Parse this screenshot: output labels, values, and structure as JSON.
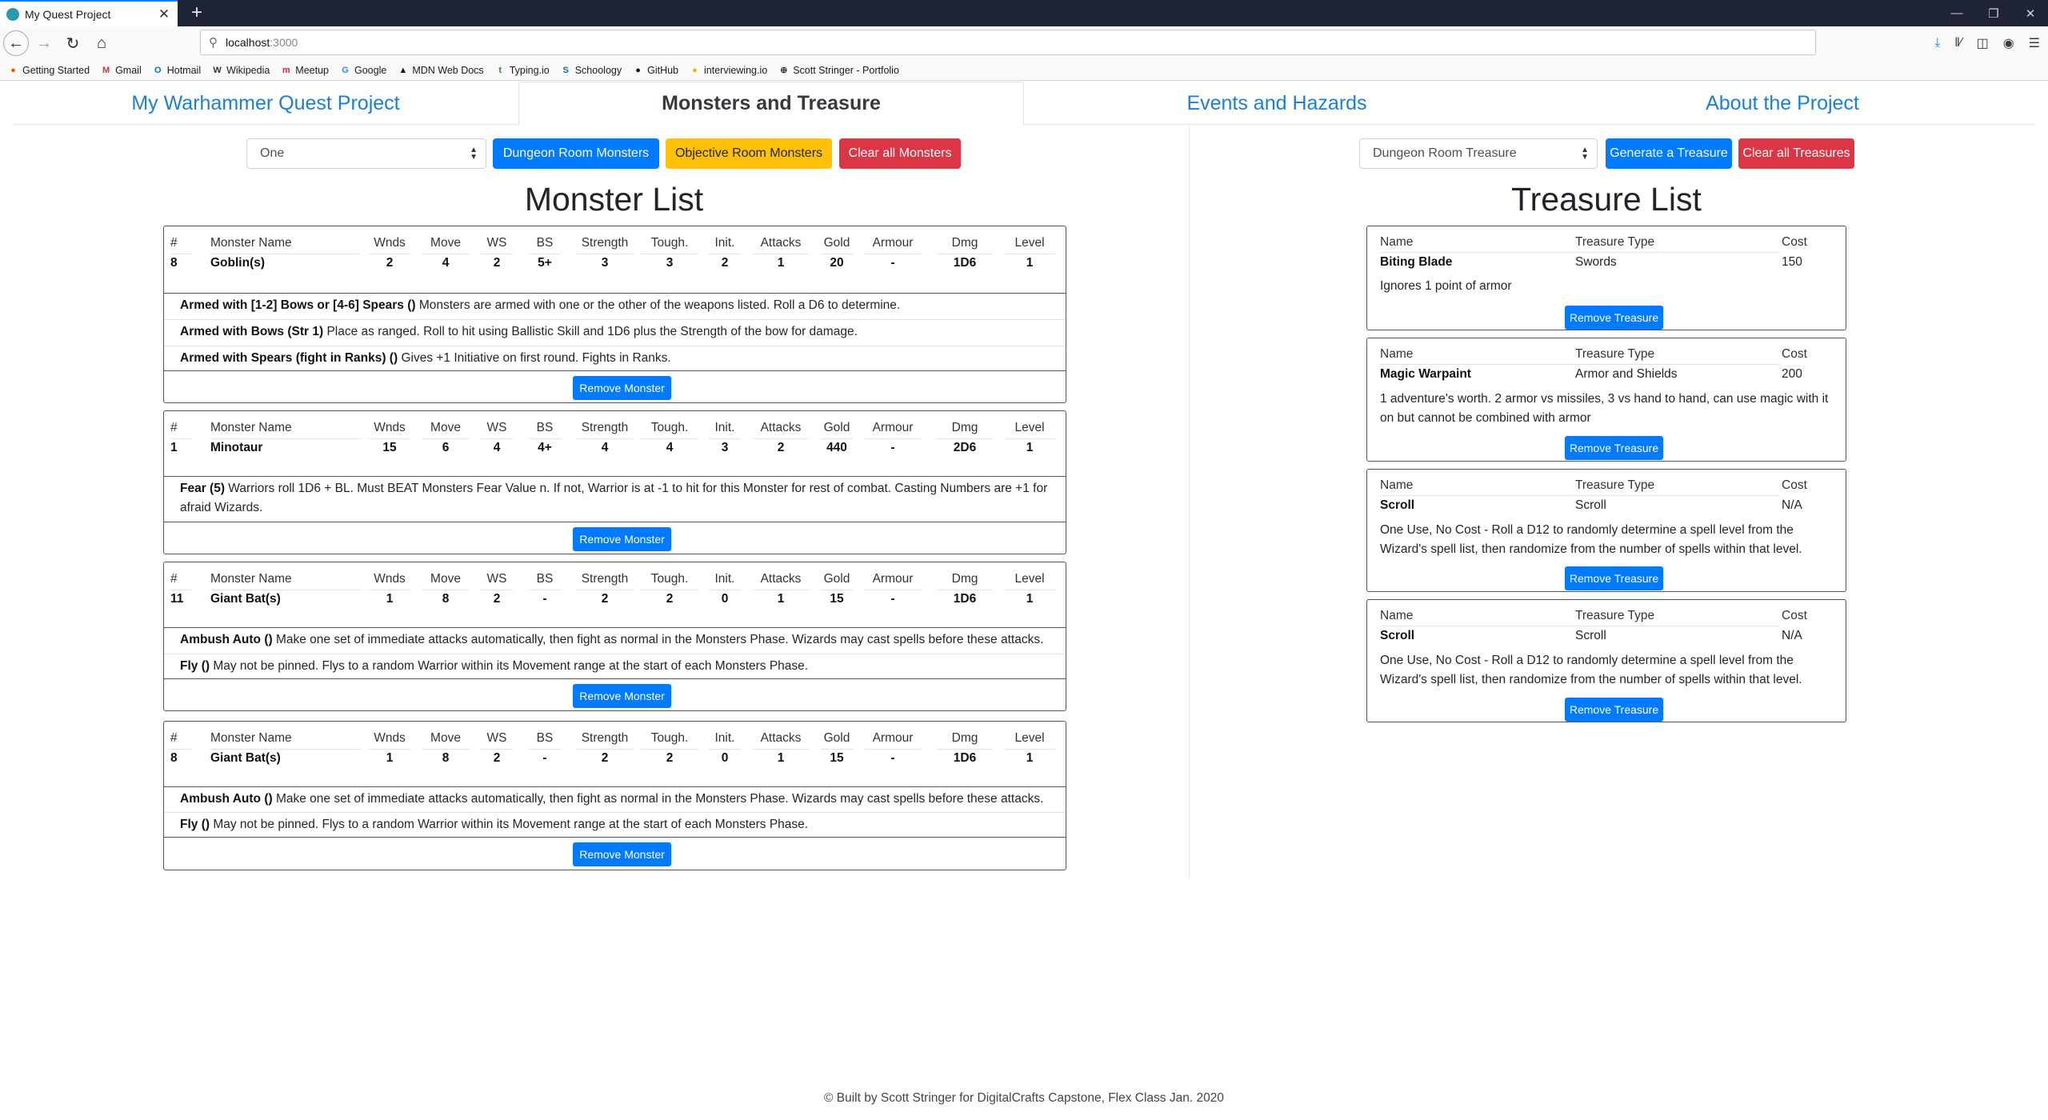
{
  "browser": {
    "tab_title": "My Quest Project",
    "tab_close": "✕",
    "new_tab": "+",
    "url_host": "localhost",
    "url_port": ":3000",
    "bookmarks": [
      {
        "label": "Getting Started",
        "icon": "firefox-icon",
        "color": "#e66000"
      },
      {
        "label": "Gmail",
        "icon": "gmail-icon",
        "color": "#d93025"
      },
      {
        "label": "Hotmail",
        "icon": "outlook-icon",
        "color": "#0072c6"
      },
      {
        "label": "Wikipedia",
        "icon": "wikipedia-icon",
        "color": "#333333"
      },
      {
        "label": "Meetup",
        "icon": "meetup-icon",
        "color": "#ed1c40"
      },
      {
        "label": "Google",
        "icon": "google-icon",
        "color": "#4285f4"
      },
      {
        "label": "MDN Web Docs",
        "icon": "mdn-icon",
        "color": "#1a1a1a"
      },
      {
        "label": "Typing.io",
        "icon": "typing-icon",
        "color": "#2e7d32"
      },
      {
        "label": "Schoology",
        "icon": "schoology-icon",
        "color": "#0b6e99"
      },
      {
        "label": "GitHub",
        "icon": "github-icon",
        "color": "#111111"
      },
      {
        "label": "interviewing.io",
        "icon": "interviewing-icon",
        "color": "#e6b800"
      },
      {
        "label": "Scott Stringer - Portfolio",
        "icon": "globe-icon",
        "color": "#333333"
      }
    ]
  },
  "nav": {
    "tabs": [
      {
        "label": "My Warhammer Quest Project",
        "active": false
      },
      {
        "label": "Monsters and Treasure",
        "active": true
      },
      {
        "label": "Events and Hazards",
        "active": false
      },
      {
        "label": "About the Project",
        "active": false
      }
    ]
  },
  "monster_controls": {
    "count_select": "One",
    "dungeon_btn": "Dungeon Room Monsters",
    "objective_btn": "Objective Room Monsters",
    "clear_btn": "Clear all Monsters"
  },
  "treasure_controls": {
    "type_select": "Dungeon Room Treasure",
    "generate_btn": "Generate a Treasure",
    "clear_btn": "Clear all Treasures"
  },
  "monster_list": {
    "title": "Monster List",
    "headers": [
      "#",
      "Monster Name",
      "Wnds",
      "Move",
      "WS",
      "BS",
      "Strength",
      "Tough.",
      "Init.",
      "Attacks",
      "Gold",
      "Armour",
      "Dmg",
      "Level"
    ],
    "remove_label": "Remove Monster",
    "monsters": [
      {
        "values": [
          "8",
          "Goblin(s)",
          "2",
          "4",
          "2",
          "5+",
          "3",
          "3",
          "2",
          "1",
          "20",
          "-",
          "1D6",
          "1"
        ],
        "abilities": [
          {
            "name": "Armed with [1-2] Bows or [4-6] Spears ()",
            "text": " Monsters are armed with one or the other of the weapons listed. Roll a D6 to determine."
          },
          {
            "name": "Armed with Bows (Str 1)",
            "text": " Place as ranged. Roll to hit using Ballistic Skill and 1D6 plus the Strength of the bow for damage."
          },
          {
            "name": "Armed with Spears (fight in Ranks) ()",
            "text": " Gives +1 Initiative on first round. Fights in Ranks."
          }
        ]
      },
      {
        "values": [
          "1",
          "Minotaur",
          "15",
          "6",
          "4",
          "4+",
          "4",
          "4",
          "3",
          "2",
          "440",
          "-",
          "2D6",
          "1"
        ],
        "abilities": [
          {
            "name": "Fear (5)",
            "text": " Warriors roll 1D6 + BL. Must BEAT Monsters Fear Value n. If not, Warrior is at -1 to hit for this Monster for rest of combat. Casting Numbers are  +1 for afraid Wizards."
          }
        ]
      },
      {
        "values": [
          "11",
          "Giant Bat(s)",
          "1",
          "8",
          "2",
          "-",
          "2",
          "2",
          "0",
          "1",
          "15",
          "-",
          "1D6",
          "1"
        ],
        "abilities": [
          {
            "name": "Ambush Auto ()",
            "text": " Make one set of immediate attacks automatically, then fight as normal in the Monsters Phase. Wizards may cast spells before these attacks."
          },
          {
            "name": "Fly ()",
            "text": " May not be pinned. Flys to a random Warrior within its Movement range at the start of each Monsters Phase."
          }
        ]
      },
      {
        "values": [
          "8",
          "Giant Bat(s)",
          "1",
          "8",
          "2",
          "-",
          "2",
          "2",
          "0",
          "1",
          "15",
          "-",
          "1D6",
          "1"
        ],
        "abilities": [
          {
            "name": "Ambush Auto ()",
            "text": " Make one set of immediate attacks automatically, then fight as normal in the Monsters Phase. Wizards may cast spells before these attacks."
          },
          {
            "name": "Fly ()",
            "text": " May not be pinned. Flys to a random Warrior within its Movement range at the start of each Monsters Phase."
          }
        ]
      }
    ]
  },
  "treasure_list": {
    "title": "Treasure List",
    "headers": {
      "name": "Name",
      "type": "Treasure Type",
      "cost": "Cost"
    },
    "remove_label": "Remove Treasure",
    "items": [
      {
        "name": "Biting Blade",
        "type": "Swords",
        "cost": "150",
        "desc": "Ignores 1 point of armor"
      },
      {
        "name": "Magic Warpaint",
        "type": "Armor and Shields",
        "cost": "200",
        "desc": "1 adventure's worth. 2 armor vs missiles, 3 vs hand to hand, can use magic with it on but cannot be combined with armor"
      },
      {
        "name": "Scroll",
        "type": "Scroll",
        "cost": "N/A",
        "desc": "One Use, No Cost - Roll a D12 to randomly determine a spell level from the Wizard's spell list, then randomize from the number of spells within that level."
      },
      {
        "name": "Scroll",
        "type": "Scroll",
        "cost": "N/A",
        "desc": "One Use, No Cost - Roll a D12 to randomly determine a spell level from the Wizard's spell list, then randomize from the number of spells within that level."
      }
    ]
  },
  "footer": "© Built by Scott Stringer for DigitalCrafts Capstone, Flex Class Jan. 2020"
}
